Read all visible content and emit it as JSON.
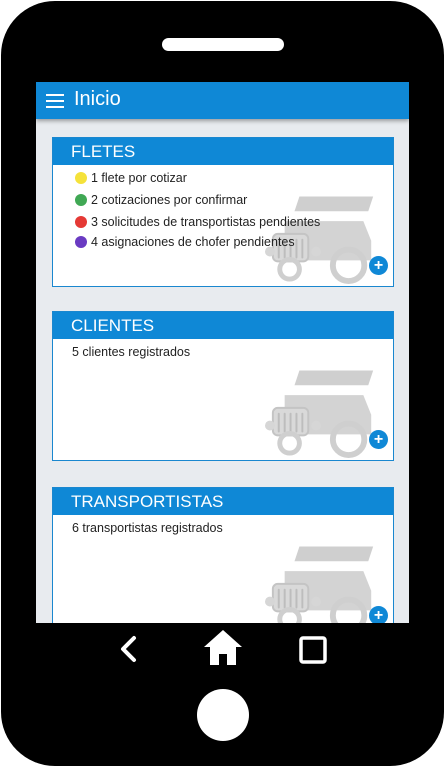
{
  "appbar": {
    "title": "Inicio"
  },
  "fletes": {
    "title": "FLETES",
    "items": [
      {
        "color": "#f5e23a",
        "text": "1 flete por cotizar"
      },
      {
        "color": "#40a854",
        "text": "2 cotizaciones por confirmar"
      },
      {
        "color": "#e53935",
        "text": "3 solicitudes de transportistas pendientes"
      },
      {
        "color": "#6a3bc2",
        "text": "4 asignaciones de chofer pendientes"
      }
    ]
  },
  "clientes": {
    "title": "CLIENTES",
    "text": "5 clientes registrados"
  },
  "transportistas": {
    "title": "TRANSPORTISTAS",
    "text": "6 transportistas registrados"
  },
  "icons": {
    "add": "+",
    "back": "chevron-left-icon",
    "home": "home-icon",
    "recents": "square-icon"
  },
  "colors": {
    "primary": "#0f88d6",
    "background": "#e8ebef"
  }
}
